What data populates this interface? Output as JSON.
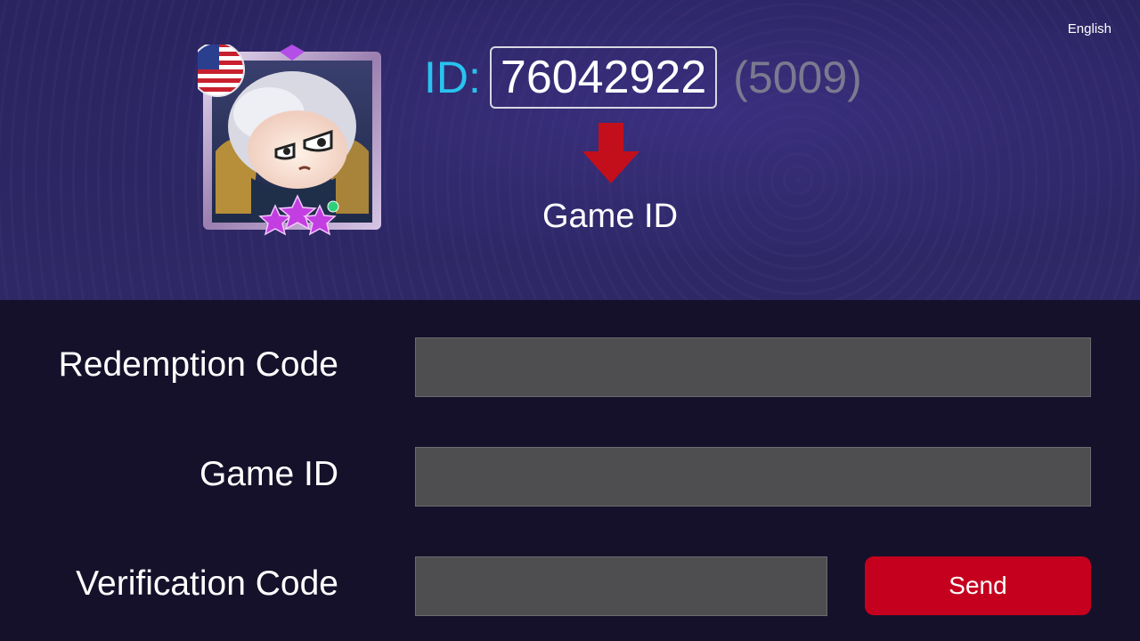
{
  "header": {
    "language": "English",
    "id_prefix": "ID:",
    "game_id_value": "76042922",
    "zone_id": "(5009)",
    "arrow_caption": "Game ID"
  },
  "form": {
    "redemption_label": "Redemption Code",
    "redemption_value": "",
    "game_id_label": "Game ID",
    "game_id_value": "",
    "verification_label": "Verification Code",
    "verification_value": "",
    "send_label": "Send"
  },
  "colors": {
    "banner_bg": "#2c2663",
    "page_bg": "#15112a",
    "id_label": "#28c3ee",
    "zone_text": "#7c7990",
    "arrow": "#c30f1c",
    "input_bg": "#4e4e50",
    "send_button": "#c5001e"
  },
  "icons": {
    "flag": "us-flag-icon",
    "avatar": "hero-avatar",
    "arrow": "arrow-down-icon"
  }
}
